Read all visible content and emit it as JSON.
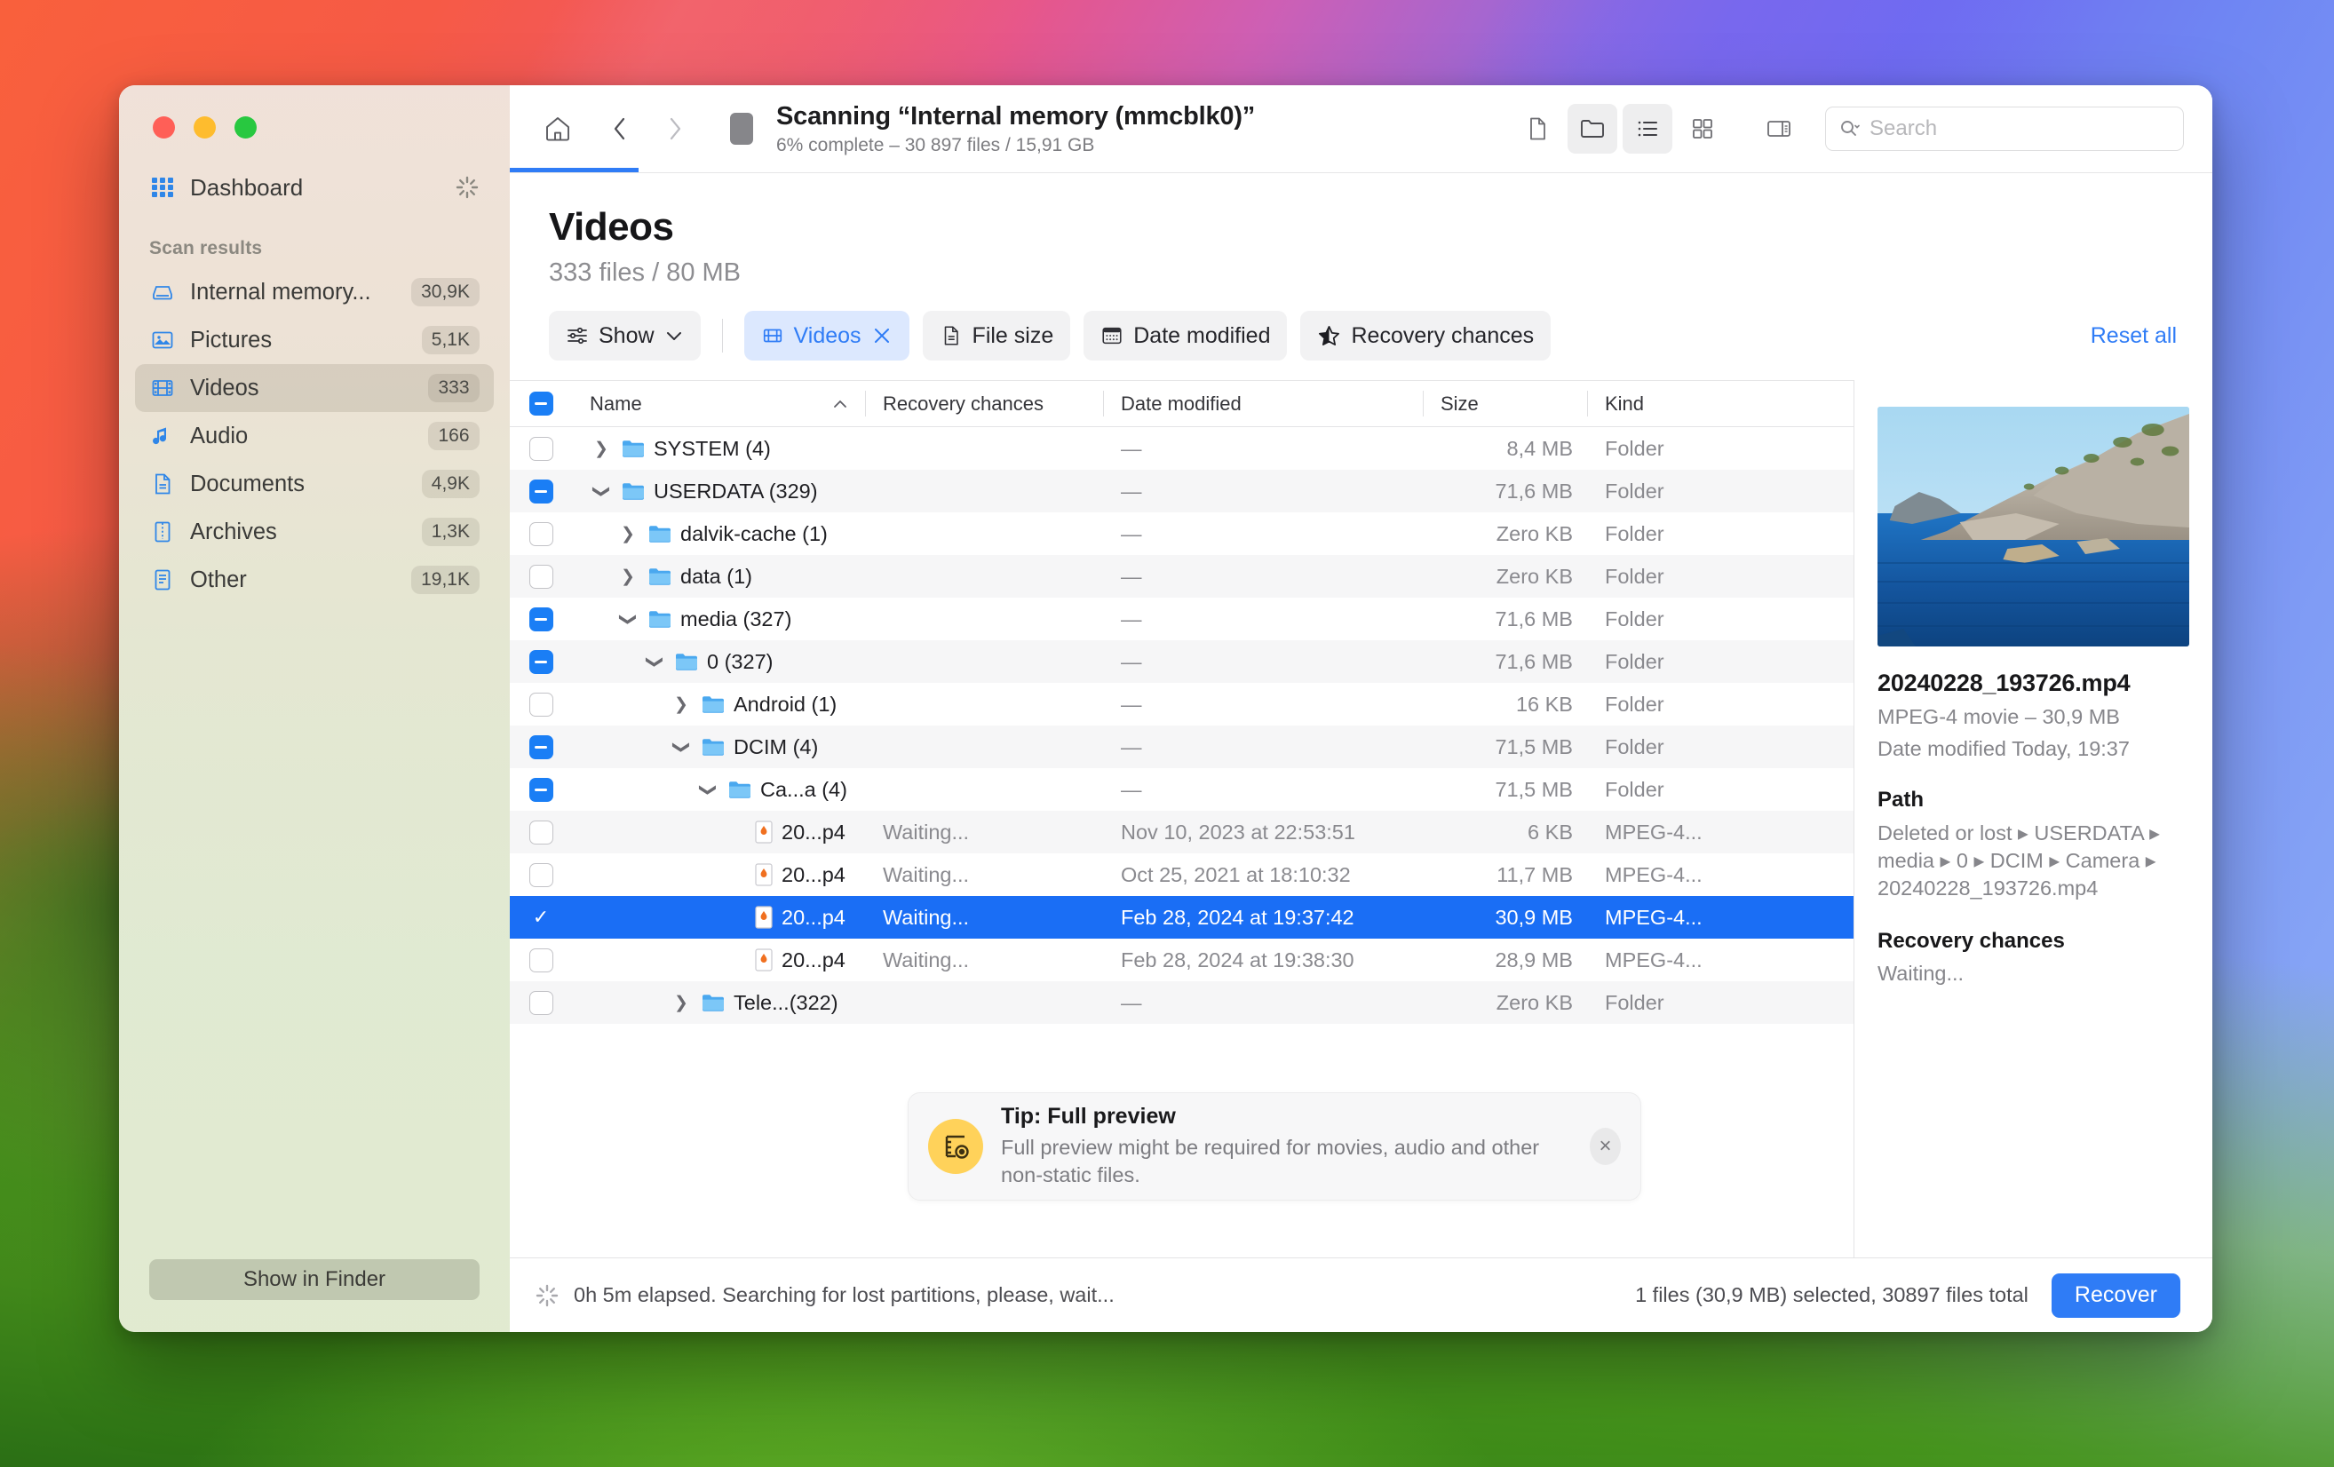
{
  "window": {
    "traffic_lights": [
      "close",
      "minimize",
      "maximize"
    ]
  },
  "sidebar": {
    "dashboard_label": "Dashboard",
    "section_title": "Scan results",
    "items": [
      {
        "label": "Internal memory...",
        "count": "30,9K",
        "icon": "drive-icon"
      },
      {
        "label": "Pictures",
        "count": "5,1K",
        "icon": "pictures-icon"
      },
      {
        "label": "Videos",
        "count": "333",
        "icon": "video-icon"
      },
      {
        "label": "Audio",
        "count": "166",
        "icon": "audio-icon"
      },
      {
        "label": "Documents",
        "count": "4,9K",
        "icon": "document-icon"
      },
      {
        "label": "Archives",
        "count": "1,3K",
        "icon": "archive-icon"
      },
      {
        "label": "Other",
        "count": "19,1K",
        "icon": "other-icon"
      }
    ],
    "show_in_finder_label": "Show in Finder"
  },
  "toolbar": {
    "scan_title": "Scanning “Internal memory (mmcblk0)”",
    "scan_subtitle": "6% complete – 30 897 files / 15,91 GB",
    "search_placeholder": "Search",
    "search_value": "",
    "view_icons": [
      "file-view-icon",
      "folder-view-icon",
      "list-view-icon",
      "grid-view-icon",
      "side-panel-icon"
    ]
  },
  "page": {
    "title": "Videos",
    "subtitle": "333 files / 80 MB"
  },
  "filters": {
    "show_label": "Show",
    "chips": [
      {
        "label": "Videos",
        "icon": "video-icon",
        "active": true,
        "removable": true
      },
      {
        "label": "File size",
        "icon": "document-icon",
        "active": false,
        "removable": false
      },
      {
        "label": "Date modified",
        "icon": "calendar-icon",
        "active": false,
        "removable": false
      },
      {
        "label": "Recovery chances",
        "icon": "star-icon",
        "active": false,
        "removable": false
      }
    ],
    "reset_label": "Reset all"
  },
  "table": {
    "columns": [
      "Name",
      "Recovery chances",
      "Date modified",
      "Size",
      "Kind"
    ],
    "sort_column": "Name",
    "sort_direction": "asc",
    "rows": [
      {
        "check": "off",
        "indent": 0,
        "disclosure": "collapsed",
        "icon": "folder-icon",
        "name": "SYSTEM (4)",
        "recovery": "",
        "date": "—",
        "size": "8,4 MB",
        "kind": "Folder",
        "selected": false
      },
      {
        "check": "mixed",
        "indent": 0,
        "disclosure": "expanded",
        "icon": "folder-icon",
        "name": "USERDATA (329)",
        "recovery": "",
        "date": "—",
        "size": "71,6 MB",
        "kind": "Folder",
        "selected": false
      },
      {
        "check": "off",
        "indent": 1,
        "disclosure": "collapsed",
        "icon": "folder-icon",
        "name": "dalvik-cache (1)",
        "recovery": "",
        "date": "—",
        "size": "Zero KB",
        "kind": "Folder",
        "selected": false
      },
      {
        "check": "off",
        "indent": 1,
        "disclosure": "collapsed",
        "icon": "folder-icon",
        "name": "data (1)",
        "recovery": "",
        "date": "—",
        "size": "Zero KB",
        "kind": "Folder",
        "selected": false
      },
      {
        "check": "mixed",
        "indent": 1,
        "disclosure": "expanded",
        "icon": "folder-icon",
        "name": "media (327)",
        "recovery": "",
        "date": "—",
        "size": "71,6 MB",
        "kind": "Folder",
        "selected": false
      },
      {
        "check": "mixed",
        "indent": 2,
        "disclosure": "expanded",
        "icon": "folder-icon",
        "name": "0 (327)",
        "recovery": "",
        "date": "—",
        "size": "71,6 MB",
        "kind": "Folder",
        "selected": false
      },
      {
        "check": "off",
        "indent": 3,
        "disclosure": "collapsed",
        "icon": "folder-icon",
        "name": "Android (1)",
        "recovery": "",
        "date": "—",
        "size": "16 KB",
        "kind": "Folder",
        "selected": false
      },
      {
        "check": "mixed",
        "indent": 3,
        "disclosure": "expanded",
        "icon": "folder-icon",
        "name": "DCIM (4)",
        "recovery": "",
        "date": "—",
        "size": "71,5 MB",
        "kind": "Folder",
        "selected": false
      },
      {
        "check": "mixed",
        "indent": 4,
        "disclosure": "expanded",
        "icon": "folder-icon",
        "name": "Ca...a (4)",
        "recovery": "",
        "date": "—",
        "size": "71,5 MB",
        "kind": "Folder",
        "selected": false
      },
      {
        "check": "off",
        "indent": 5,
        "disclosure": "none",
        "icon": "video-file-icon",
        "name": "20...p4",
        "recovery": "Waiting...",
        "date": "Nov 10, 2023 at 22:53:51",
        "size": "6 KB",
        "kind": "MPEG-4...",
        "selected": false
      },
      {
        "check": "off",
        "indent": 5,
        "disclosure": "none",
        "icon": "video-file-icon",
        "name": "20...p4",
        "recovery": "Waiting...",
        "date": "Oct 25, 2021 at 18:10:32",
        "size": "11,7 MB",
        "kind": "MPEG-4...",
        "selected": false
      },
      {
        "check": "on",
        "indent": 5,
        "disclosure": "none",
        "icon": "video-file-icon",
        "name": "20...p4",
        "recovery": "Waiting...",
        "date": "Feb 28, 2024 at 19:37:42",
        "size": "30,9 MB",
        "kind": "MPEG-4...",
        "selected": true
      },
      {
        "check": "off",
        "indent": 5,
        "disclosure": "none",
        "icon": "video-file-icon",
        "name": "20...p4",
        "recovery": "Waiting...",
        "date": "Feb 28, 2024 at 19:38:30",
        "size": "28,9 MB",
        "kind": "MPEG-4...",
        "selected": false
      },
      {
        "check": "off",
        "indent": 3,
        "disclosure": "collapsed",
        "icon": "folder-icon",
        "name": "Tele...(322)",
        "recovery": "",
        "date": "—",
        "size": "Zero KB",
        "kind": "Folder",
        "selected": false
      }
    ]
  },
  "preview": {
    "file_name": "20240228_193726.mp4",
    "kind_size": "MPEG-4 movie – 30,9 MB",
    "date_modified": "Date modified Today, 19:37",
    "path_heading": "Path",
    "path_value": "Deleted or lost ▸ USERDATA ▸ media ▸ 0 ▸ DCIM ▸ Camera ▸ 20240228_193726.mp4",
    "recovery_heading": "Recovery chances",
    "recovery_value": "Waiting..."
  },
  "tip": {
    "title": "Tip: Full preview",
    "body": "Full preview might be required for movies, audio and other non-static files.",
    "close_label": "×"
  },
  "status": {
    "progress_text": "0h 5m elapsed. Searching for lost partitions, please, wait...",
    "selection_text": "1 files (30,9 MB) selected, 30897 files total",
    "recover_label": "Recover"
  },
  "colors": {
    "accent_blue": "#2f7cf6",
    "selection_blue": "#1a6ef5",
    "tip_yellow": "#ffd25a"
  }
}
